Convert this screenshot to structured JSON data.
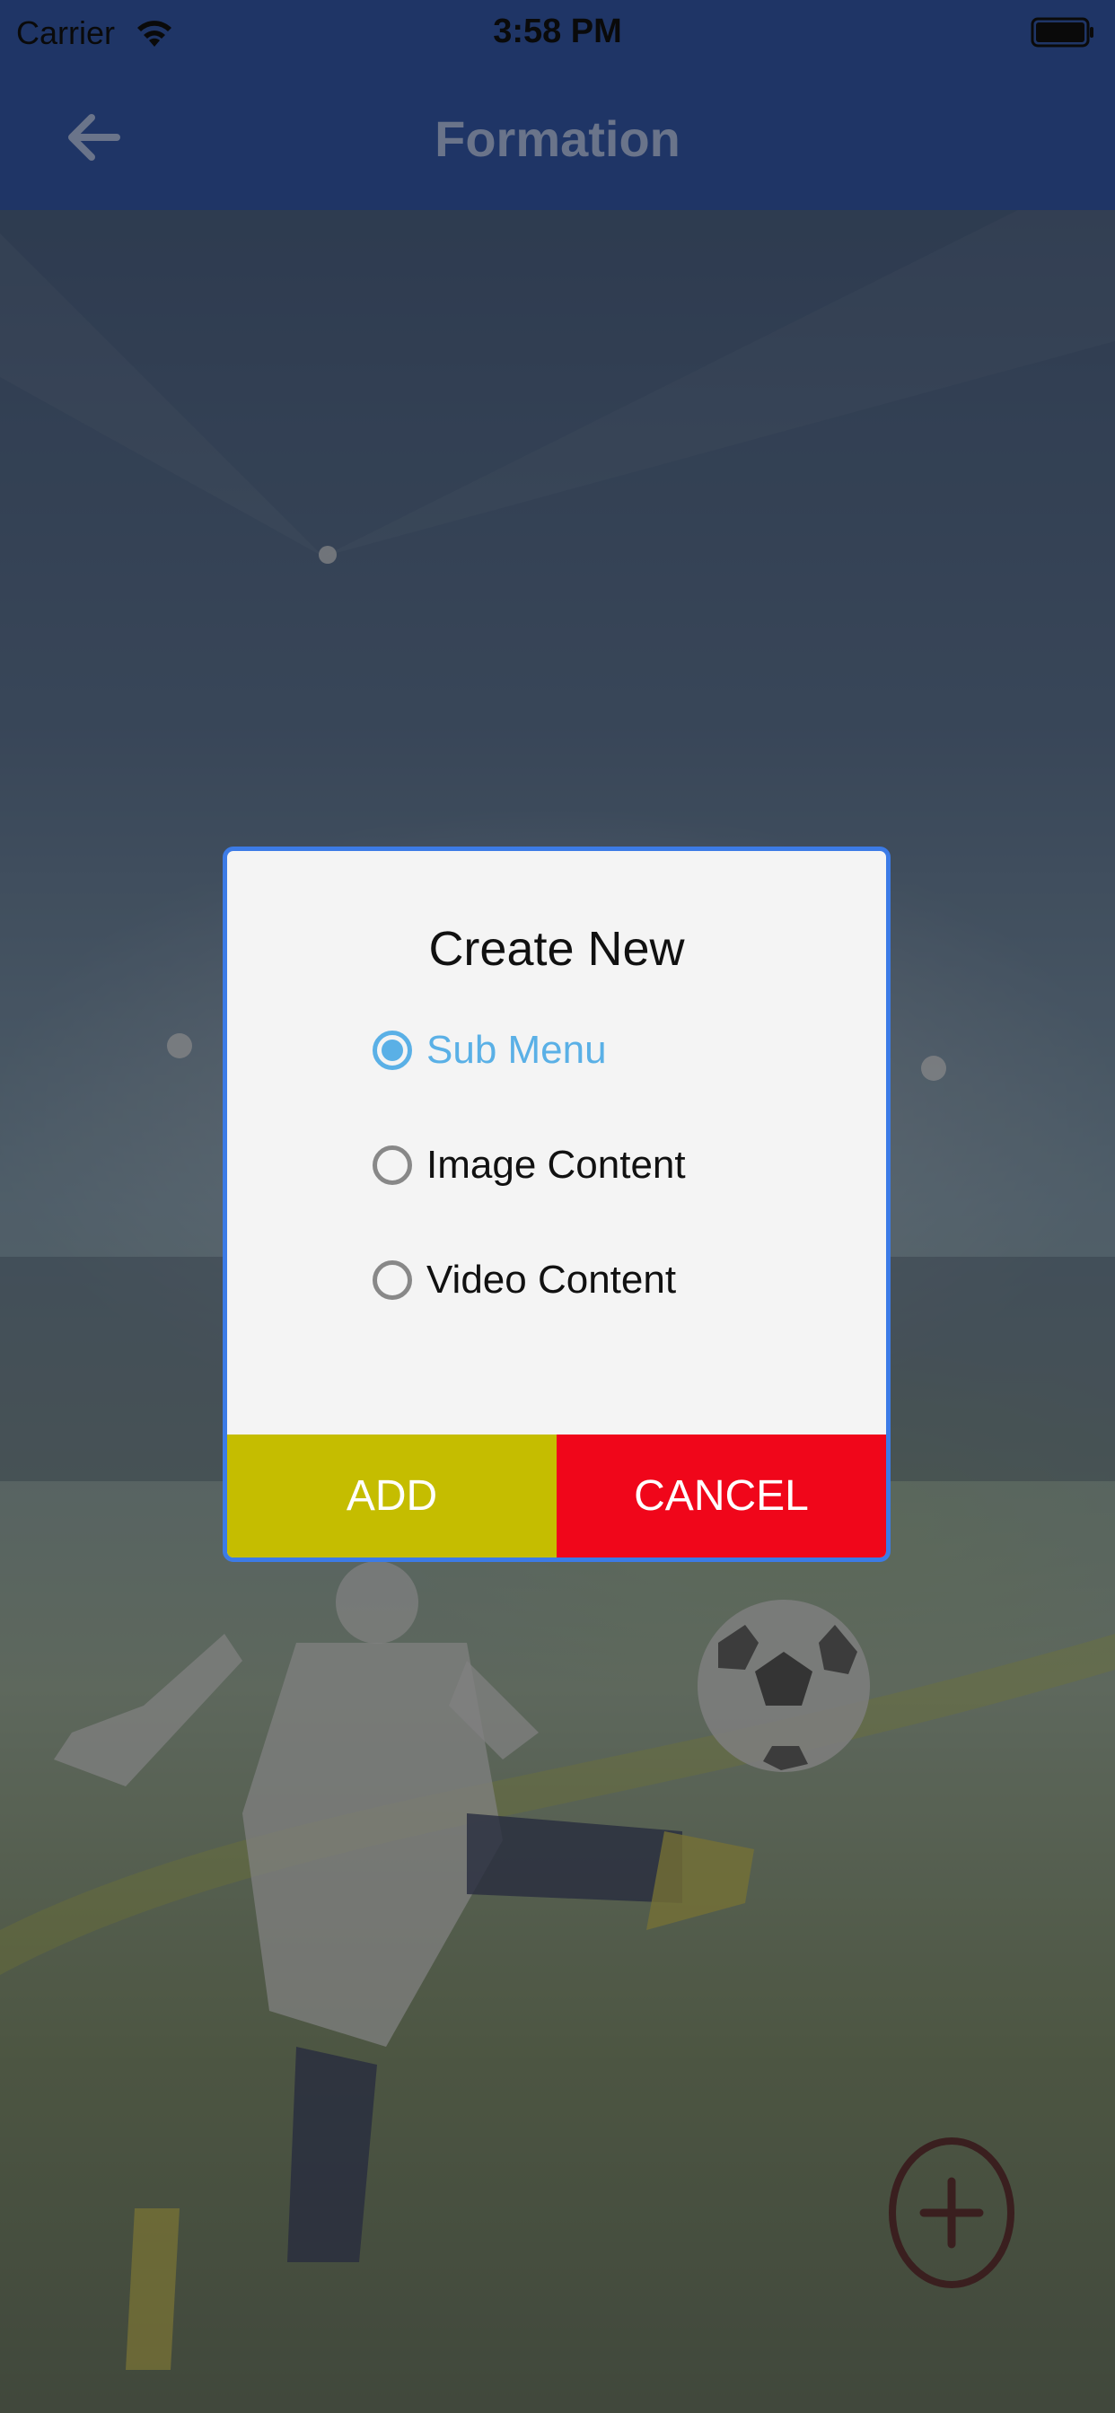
{
  "status_bar": {
    "carrier": "Carrier",
    "time": "3:58 PM"
  },
  "nav": {
    "title": "Formation"
  },
  "dialog": {
    "title": "Create New",
    "options": [
      {
        "label": "Sub Menu",
        "selected": true
      },
      {
        "label": "Image Content",
        "selected": false
      },
      {
        "label": "Video Content",
        "selected": false
      }
    ],
    "add_label": "ADD",
    "cancel_label": "CANCEL"
  },
  "colors": {
    "nav_bar": "#1f3566",
    "dialog_border": "#3c7be6",
    "radio_selected": "#5ab0e6",
    "add_button": "#c5bd00",
    "cancel_button": "#f0061a"
  },
  "icons": {
    "back": "arrow-left-icon",
    "fab": "plus-circle-icon",
    "wifi": "wifi-icon",
    "battery": "battery-icon"
  }
}
